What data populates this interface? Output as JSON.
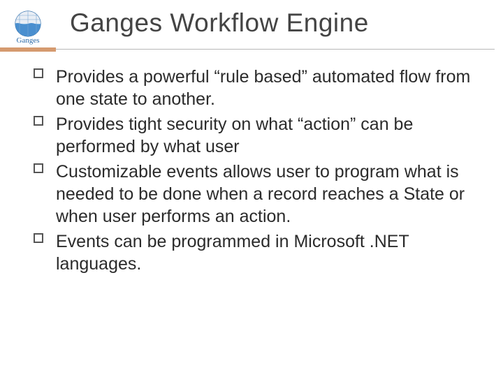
{
  "header": {
    "title": "Ganges Workflow Engine",
    "logo_label": "Ganges"
  },
  "bullets": [
    "Provides a powerful “rule based” automated flow from one state to another.",
    "Provides tight security on what “action” can be performed by what user",
    "Customizable events allows user to program what is needed to be done when a record reaches a State or when user performs an action.",
    "Events can be programmed in Microsoft .NET languages."
  ]
}
